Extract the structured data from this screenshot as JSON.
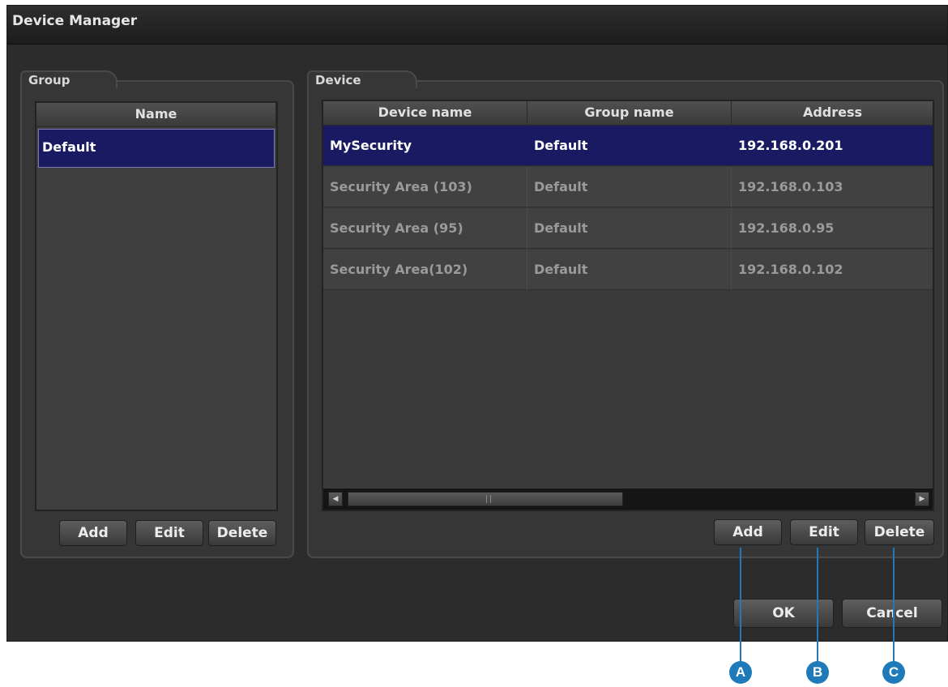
{
  "window": {
    "title": "Device Manager"
  },
  "group": {
    "tab_label": "Group",
    "column": "Name",
    "items": [
      "Default"
    ],
    "buttons": {
      "add": "Add",
      "edit": "Edit",
      "delete": "Delete"
    }
  },
  "device": {
    "tab_label": "Device",
    "columns": [
      "Device name",
      "Group name",
      "Address"
    ],
    "rows": [
      {
        "name": "MySecurity",
        "group": "Default",
        "address": "192.168.0.201",
        "selected": true
      },
      {
        "name": "Security Area (103)",
        "group": "Default",
        "address": "192.168.0.103",
        "selected": false
      },
      {
        "name": "Security Area (95)",
        "group": "Default",
        "address": "192.168.0.95",
        "selected": false
      },
      {
        "name": "Security Area(102)",
        "group": "Default",
        "address": "192.168.0.102",
        "selected": false
      }
    ],
    "buttons": {
      "add": "Add",
      "edit": "Edit",
      "delete": "Delete"
    }
  },
  "dialog": {
    "ok": "OK",
    "cancel": "Cancel"
  },
  "callouts": [
    "A",
    "B",
    "C"
  ],
  "colors": {
    "selection": "#1a1a62",
    "callout": "#1e7ab8"
  }
}
